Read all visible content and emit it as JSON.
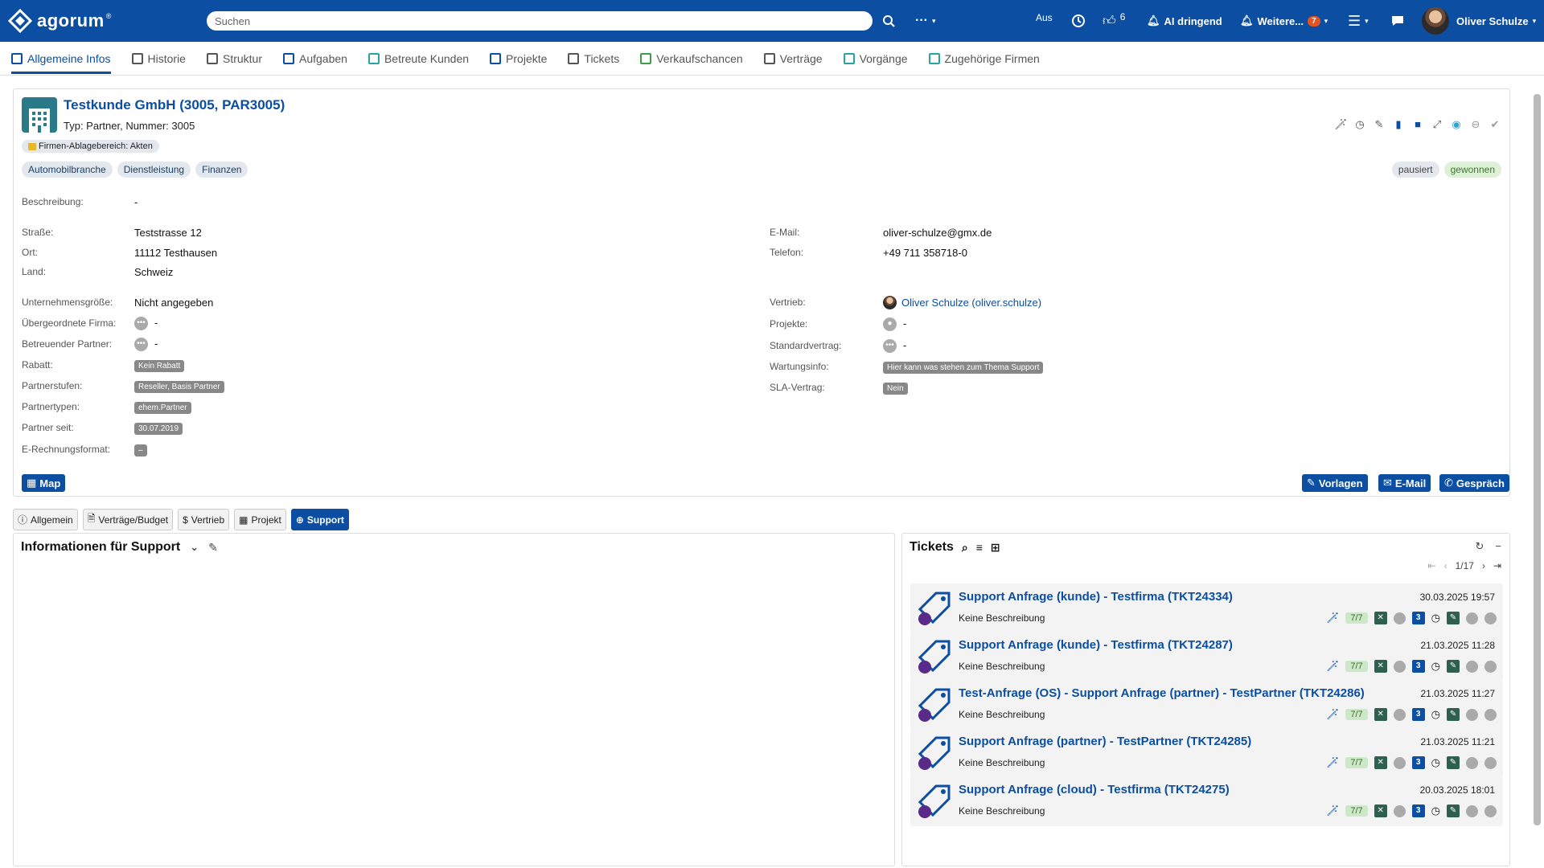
{
  "topbar": {
    "logo": "agorum",
    "search_placeholder": "Suchen",
    "more": "···",
    "aus": "Aus",
    "likes": "6",
    "ai": "AI dringend",
    "weitere": "Weitere...",
    "weitere_count": "7",
    "user": "Oliver Schulze"
  },
  "tabs": [
    {
      "label": "Allgemeine Infos",
      "color": "#0b4ea2"
    },
    {
      "label": "Historie",
      "color": "#555"
    },
    {
      "label": "Struktur",
      "color": "#555"
    },
    {
      "label": "Aufgaben",
      "color": "#0b4ea2"
    },
    {
      "label": "Betreute Kunden",
      "color": "#2aa3a3"
    },
    {
      "label": "Projekte",
      "color": "#0b4ea2"
    },
    {
      "label": "Tickets",
      "color": "#555"
    },
    {
      "label": "Verkaufschancen",
      "color": "#3aa04a"
    },
    {
      "label": "Verträge",
      "color": "#555"
    },
    {
      "label": "Vorgänge",
      "color": "#2aa3a3"
    },
    {
      "label": "Zugehörige Firmen",
      "color": "#2aa3a3"
    }
  ],
  "firm": {
    "title": "Testkunde GmbH (3005, PAR3005)",
    "subtitle": "Typ: Partner, Nummer: 3005",
    "ablage": "Firmen-Ablagebereich: Akten",
    "branches": [
      "Automobilbranche",
      "Dienstleistung",
      "Finanzen"
    ],
    "status_paused": "pausiert",
    "status_won": "gewonnen"
  },
  "fields": {
    "beschreibung_l": "Beschreibung:",
    "beschreibung_v": "-",
    "strasse_l": "Straße:",
    "strasse_v": "Teststrasse 12",
    "ort_l": "Ort:",
    "ort_v": "11112 Testhausen",
    "land_l": "Land:",
    "land_v": "Schweiz",
    "groesse_l": "Unternehmensgröße:",
    "groesse_v": "Nicht angegeben",
    "uebergeordnet_l": "Übergeordnete Firma:",
    "uebergeordnet_v": "-",
    "partner_l": "Betreuender Partner:",
    "partner_v": "-",
    "rabatt_l": "Rabatt:",
    "rabatt_v": "Kein Rabatt",
    "stufen_l": "Partnerstufen:",
    "stufen_v": "Reseller, Basis Partner",
    "typen_l": "Partnertypen:",
    "typen_v": "ehem.Partner",
    "seit_l": "Partner seit:",
    "seit_v": "30.07.2019",
    "erech_l": "E-Rechnungsformat:",
    "erech_v": "–",
    "email_l": "E-Mail:",
    "email_v": "oliver-schulze@gmx.de",
    "telefon_l": "Telefon:",
    "telefon_v": "+49 711 358718-0",
    "vertrieb_l": "Vertrieb:",
    "vertrieb_v": "Oliver Schulze (oliver.schulze)",
    "projekte_l": "Projekte:",
    "projekte_v": "-",
    "standard_l": "Standardvertrag:",
    "standard_v": "-",
    "wartung_l": "Wartungsinfo:",
    "wartung_v": "Hier kann was stehen zum Thema Support",
    "sla_l": "SLA-Vertrag:",
    "sla_v": "Nein"
  },
  "buttons": {
    "map": "Map",
    "vorlagen": "Vorlagen",
    "email": "E-Mail",
    "gespraech": "Gespräch"
  },
  "subtabs": [
    "Allgemein",
    "Verträge/Budget",
    "Vertrieb",
    "Projekt",
    "Support"
  ],
  "support_panel": {
    "title": "Informationen für Support"
  },
  "tickets_panel": {
    "title": "Tickets",
    "pager": "1/17",
    "items": [
      {
        "title": "Support Anfrage (kunde) - Testfirma (TKT24334)",
        "desc": "Keine Beschreibung",
        "date": "30.03.2025 19:57",
        "progress": "7/7",
        "count": "3"
      },
      {
        "title": "Support Anfrage (kunde) - Testfirma (TKT24287)",
        "desc": "Keine Beschreibung",
        "date": "21.03.2025 11:28",
        "progress": "7/7",
        "count": "3"
      },
      {
        "title": "Test-Anfrage (OS) - Support Anfrage (partner) - TestPartner (TKT24286)",
        "desc": "Keine Beschreibung",
        "date": "21.03.2025 11:27",
        "progress": "7/7",
        "count": "3"
      },
      {
        "title": "Support Anfrage (partner) - TestPartner (TKT24285)",
        "desc": "Keine Beschreibung",
        "date": "21.03.2025 11:21",
        "progress": "7/7",
        "count": "3"
      },
      {
        "title": "Support Anfrage (cloud) - Testfirma (TKT24275)",
        "desc": "Keine Beschreibung",
        "date": "20.03.2025 18:01",
        "progress": "7/7",
        "count": "3"
      }
    ]
  }
}
